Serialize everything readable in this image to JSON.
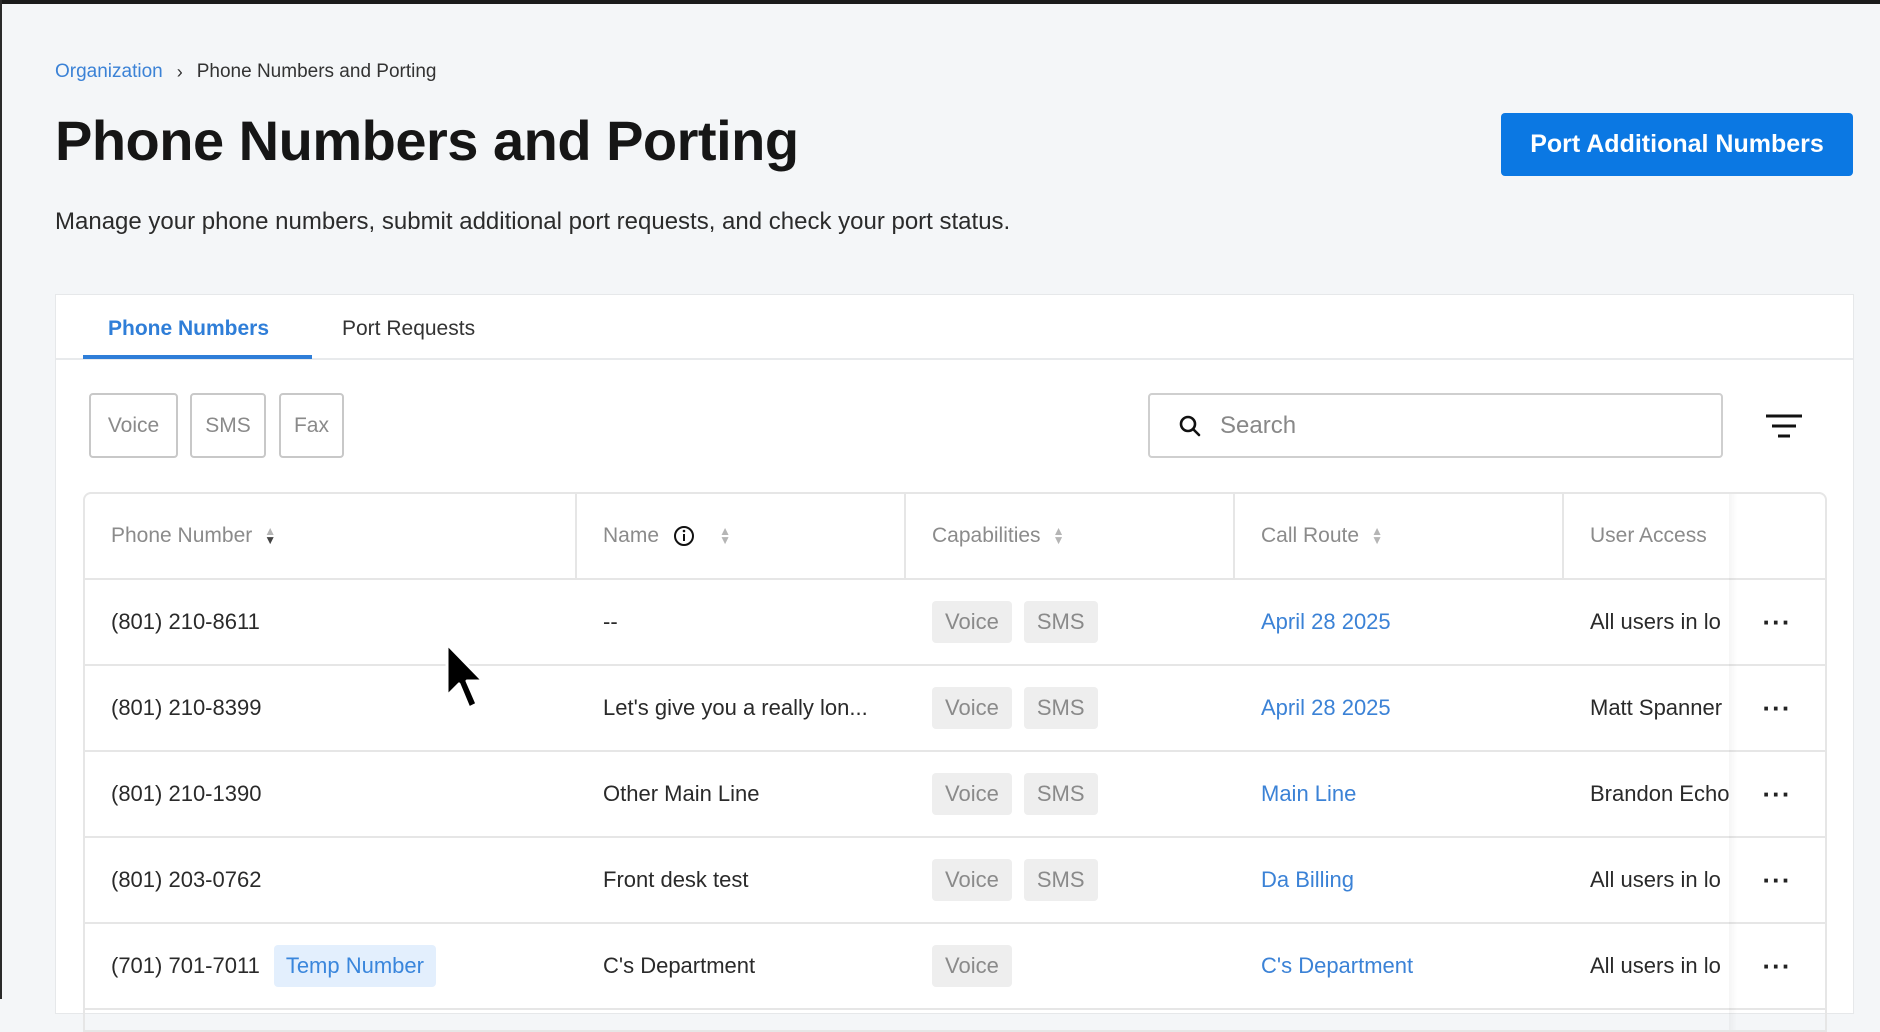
{
  "breadcrumb": {
    "parent": "Organization",
    "separator": "›",
    "current": "Phone Numbers and Porting"
  },
  "header": {
    "title": "Phone Numbers and Porting",
    "subtitle": "Manage your phone numbers, submit additional port requests, and check your port status.",
    "port_button": "Port Additional Numbers"
  },
  "tabs": [
    {
      "label": "Phone Numbers",
      "active": true
    },
    {
      "label": "Port Requests",
      "active": false
    }
  ],
  "filters": [
    "Voice",
    "SMS",
    "Fax"
  ],
  "search": {
    "placeholder": "Search",
    "value": ""
  },
  "table": {
    "columns": [
      "Phone Number",
      "Name",
      "Capabilities",
      "Call Route",
      "User Access"
    ],
    "rows": [
      {
        "phone": "(801) 210-8611",
        "badge": null,
        "name": "--",
        "capabilities": [
          "Voice",
          "SMS"
        ],
        "route": "April 28 2025",
        "access": "All users in lo",
        "actions": "···"
      },
      {
        "phone": "(801) 210-8399",
        "badge": null,
        "name": "Let's give you a really lon...",
        "capabilities": [
          "Voice",
          "SMS"
        ],
        "route": "April 28 2025",
        "access": "Matt Spanner",
        "actions": "···"
      },
      {
        "phone": "(801) 210-1390",
        "badge": null,
        "name": "Other Main Line",
        "capabilities": [
          "Voice",
          "SMS"
        ],
        "route": "Main Line",
        "access": "Brandon Echo",
        "actions": "···"
      },
      {
        "phone": "(801) 203-0762",
        "badge": null,
        "name": "Front desk test",
        "capabilities": [
          "Voice",
          "SMS"
        ],
        "route": "Da Billing",
        "access": "All users in lo",
        "actions": "···"
      },
      {
        "phone": "(701) 701-7011",
        "badge": "Temp Number",
        "name": "C's Department",
        "capabilities": [
          "Voice"
        ],
        "route": "C's Department",
        "access": "All users in lo",
        "actions": "···"
      }
    ]
  },
  "colors": {
    "accent": "#0b78e3",
    "link": "#3b82d6",
    "tag_bg": "#eeeeee",
    "temp_bg": "#e3effd"
  }
}
